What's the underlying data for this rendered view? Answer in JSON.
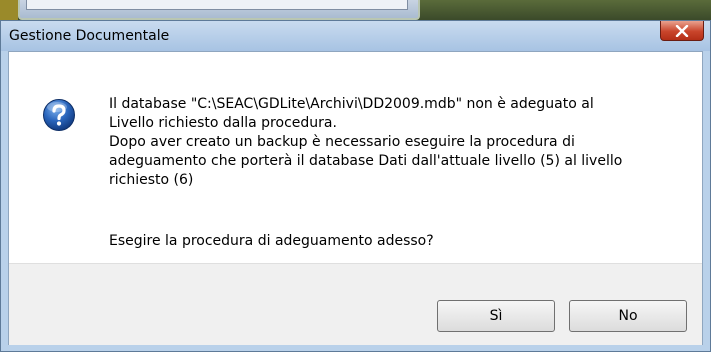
{
  "dialog": {
    "title": "Gestione Documentale",
    "message_lines": [
      "Il database \"C:\\SEAC\\GDLite\\Archivi\\DD2009.mdb\" non è adeguato al",
      "Livello richiesto dalla procedura.",
      "Dopo aver creato un backup è necessario eseguire la procedura di",
      "adeguamento che porterà il database Dati dall'attuale livello (5) al livello",
      "richiesto (6)"
    ],
    "question": "Esegire la procedura di adeguamento adesso?",
    "buttons": {
      "yes": "Sì",
      "no": "No"
    },
    "icons": {
      "close": "close-icon",
      "status": "question-icon"
    }
  },
  "colors": {
    "title_bar": "#b9d1ea",
    "close_button": "#c9452b",
    "question_icon": "#1f5aa6"
  }
}
